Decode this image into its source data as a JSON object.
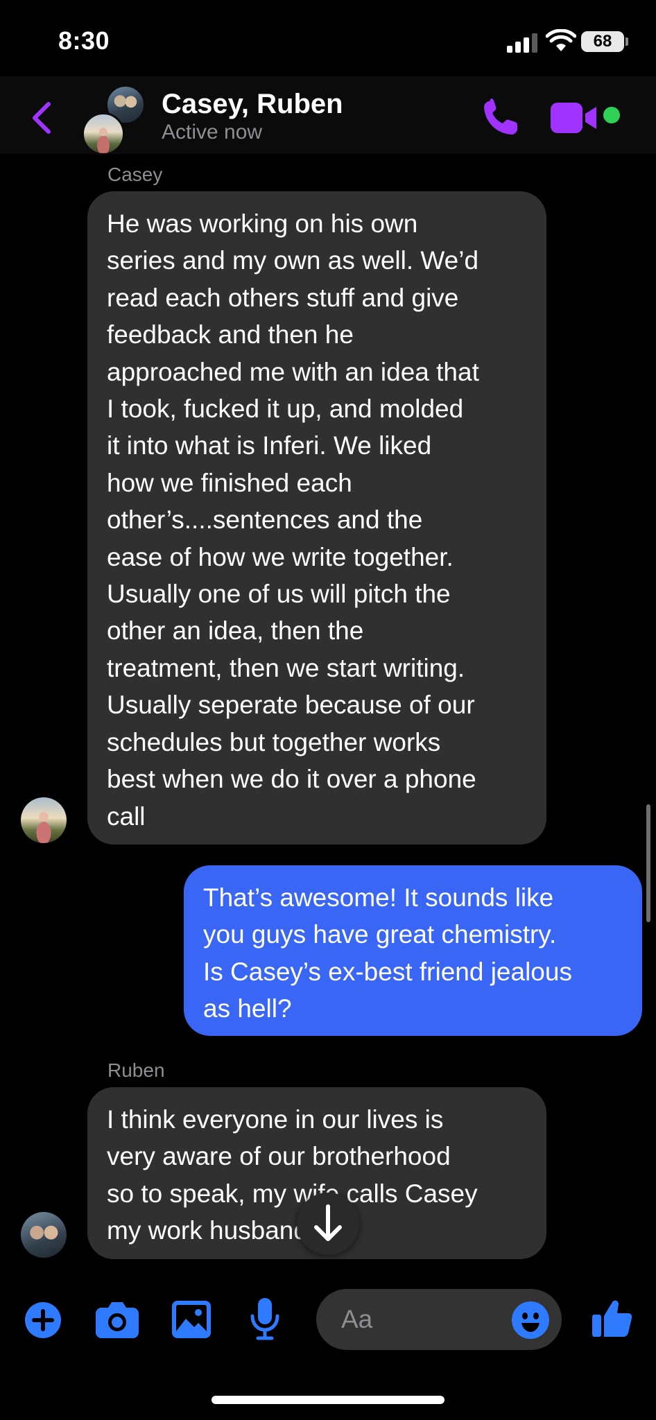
{
  "status_bar": {
    "time": "8:30",
    "battery": "68"
  },
  "header": {
    "title": "Casey, Ruben",
    "status": "Active now"
  },
  "messages": [
    {
      "sender": "Casey",
      "direction": "incoming",
      "lines": [
        "He was working on his own",
        "series and my own as well. We’d",
        "read each others stuff and give",
        "feedback and then he",
        "approached me with an idea that",
        "I took, fucked it up, and molded",
        "it into what is Inferi. We liked",
        "how we finished each",
        "other’s....sentences and the",
        "ease of how we write together.",
        "Usually one of us will pitch the",
        "other an idea, then the",
        "treatment, then we start writing.",
        "Usually seperate because of our",
        "schedules but together works",
        "best when we do it over a phone",
        "call"
      ]
    },
    {
      "sender": "",
      "direction": "outgoing",
      "lines": [
        "That’s awesome! It sounds like",
        "you guys have great chemistry.",
        "Is Casey’s ex-best friend jealous",
        "as hell?"
      ]
    },
    {
      "sender": "Ruben",
      "direction": "incoming",
      "lines": [
        "I think everyone in our lives is",
        "very aware of our brotherhood",
        "so to speak, my wife calls Casey",
        "my work husband"
      ]
    }
  ],
  "composer": {
    "placeholder": "Aa"
  },
  "colors": {
    "accent": "#a033ff",
    "outgoing_bubble": "#3a66f5",
    "incoming_bubble": "#303030",
    "composer_icon": "#2f7bff",
    "active": "#31d158"
  },
  "icons": [
    "back-icon",
    "phone-icon",
    "video-icon",
    "add-icon",
    "camera-icon",
    "gallery-icon",
    "microphone-icon",
    "emoji-icon",
    "thumbs-up-icon",
    "arrow-down-icon"
  ]
}
